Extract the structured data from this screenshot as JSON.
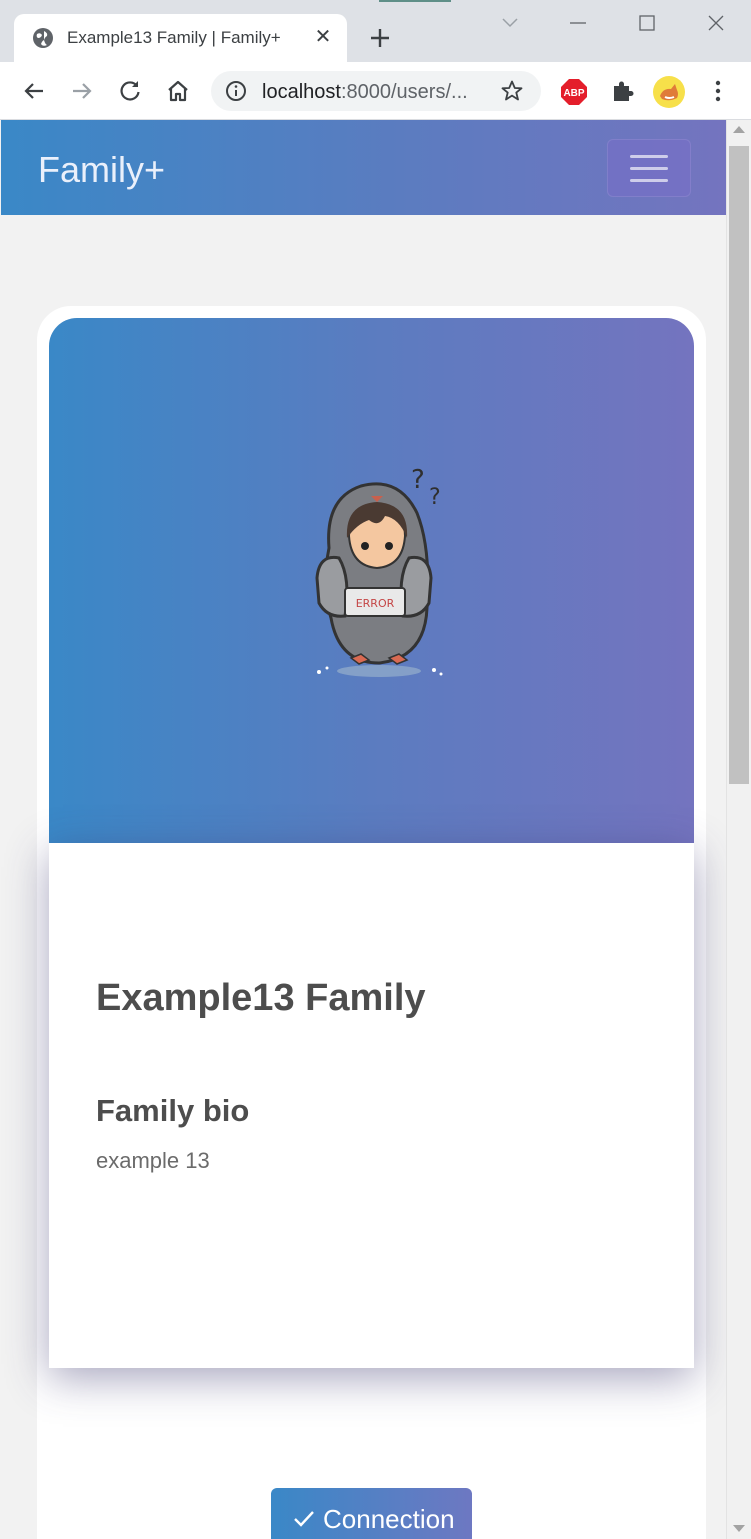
{
  "browser": {
    "tab_title": "Example13 Family | Family+",
    "tab_close_glyph": "✕",
    "url_host": "localhost",
    "url_path": ":8000/users/...",
    "icons": [
      "globe-icon",
      "close-icon",
      "plus-icon",
      "back-icon",
      "forward-icon",
      "reload-icon",
      "home-icon",
      "info-icon",
      "star-icon",
      "abp-extension-icon",
      "puzzle-icon",
      "profile-avatar-icon",
      "menu-dots-icon",
      "minimize-icon",
      "maximize-icon",
      "close-window-icon",
      "tab-search-icon"
    ],
    "abp_label": "ABP"
  },
  "navbar": {
    "brand": "Family+"
  },
  "profile": {
    "name": "Example13 Family",
    "bio_heading": "Family bio",
    "bio_text": "example 13",
    "image_label": "ERROR"
  },
  "actions": {
    "connection_label": "Connection"
  },
  "colors": {
    "gradient_start": "#3a88c7",
    "gradient_end": "#7474bf",
    "page_bg": "#f2f2f2",
    "heading_text": "#4d4d4d"
  }
}
